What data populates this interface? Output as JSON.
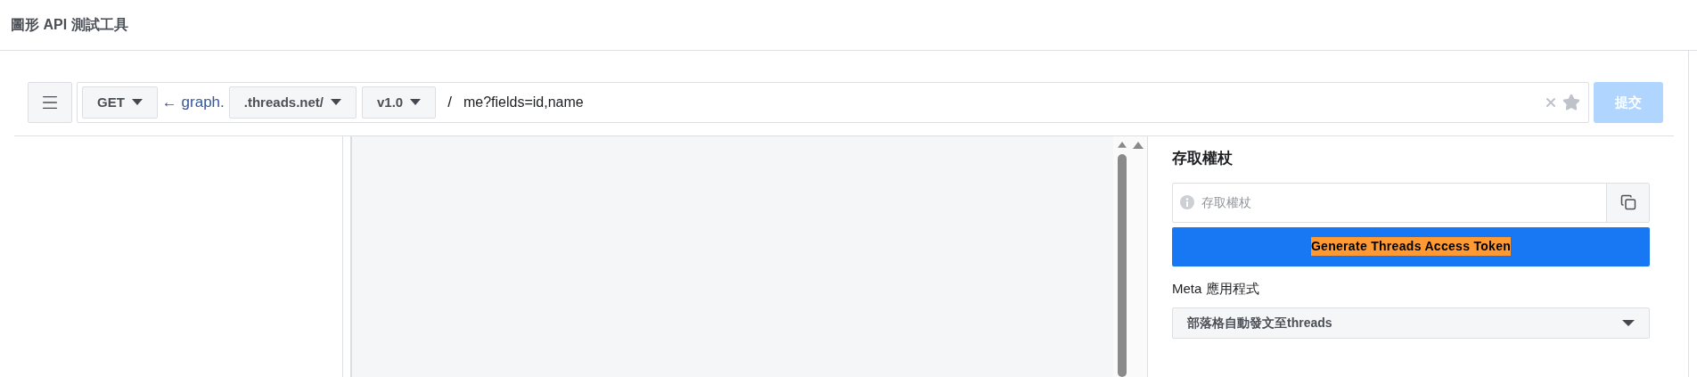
{
  "header": {
    "title": "圖形 API 測試工具"
  },
  "request_bar": {
    "method": "GET",
    "host_prefix": "← graph.",
    "domain": ".threads.net/",
    "version": "v1.0",
    "separator": "/",
    "path": "me?fields=id,name",
    "submit": {
      "label": "提交",
      "disabled": true
    }
  },
  "access_token_panel": {
    "heading": "存取權杖",
    "token_field": {
      "placeholder": "存取權杖"
    },
    "generate_button": "Generate Threads Access Token",
    "app_label": "Meta 應用程式",
    "app_select": "部落格自動發文至threads"
  }
}
